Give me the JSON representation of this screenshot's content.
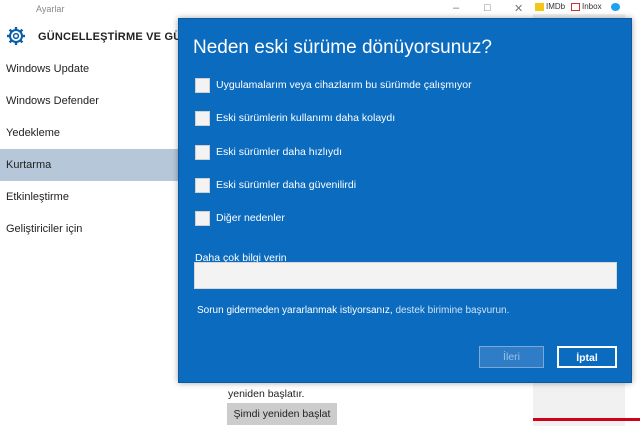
{
  "settings": {
    "window_title": "Ayarlar",
    "header_title": "GÜNCELLEŞTİRME VE GÜVENLİ",
    "nav": [
      {
        "label": "Windows Update"
      },
      {
        "label": "Windows Defender"
      },
      {
        "label": "Yedekleme"
      },
      {
        "label": "Kurtarma"
      },
      {
        "label": "Etkinleştirme"
      },
      {
        "label": "Geliştiriciler için"
      }
    ],
    "selected_nav": "Kurtarma",
    "restart_text": "yeniden başlatır.",
    "restart_button": "Şimdi yeniden başlat"
  },
  "browser": {
    "bookmarks": [
      {
        "label": "IMDb",
        "icon": "imdb-icon"
      },
      {
        "label": "Inbox",
        "icon": "gmail-icon"
      },
      {
        "label": "",
        "icon": "twitter-icon"
      }
    ]
  },
  "dialog": {
    "title": "Neden eski sürüme dönüyorsunuz?",
    "reasons": [
      {
        "label": "Uygulamalarım veya cihazlarım bu sürümde çalışmıyor",
        "checked": false
      },
      {
        "label": "Eski sürümlerin kullanımı daha kolaydı",
        "checked": false
      },
      {
        "label": "Eski sürümler daha hızlıydı",
        "checked": false
      },
      {
        "label": "Eski sürümler daha güvenilirdi",
        "checked": false
      },
      {
        "label": "Diğer nedenler",
        "checked": false
      }
    ],
    "more_info_label": "Daha çok bilgi verin",
    "more_info_value": "",
    "help_text": "Sorun gidermeden yararlanmak istiyorsanız,",
    "help_link": "destek birimine başvurun.",
    "next_button": "İleri",
    "cancel_button": "İptal",
    "colors": {
      "background": "#0b6bbf",
      "text": "#ffffff"
    }
  }
}
